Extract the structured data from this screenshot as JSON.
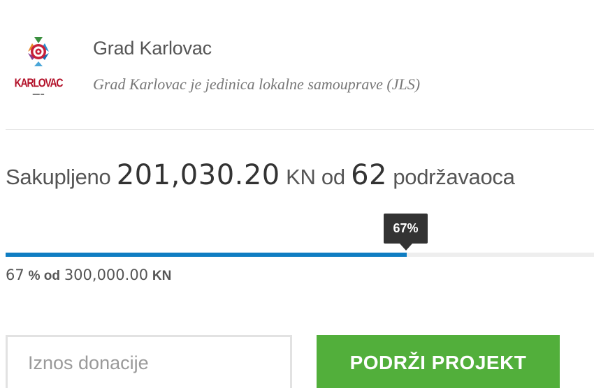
{
  "organizer": {
    "logo_text": "KARLOVAC",
    "name": "Grad Karlovac",
    "description": "Grad Karlovac je jedinica lokalne samouprave (JLS)"
  },
  "raised": {
    "prefix": "Sakupljeno",
    "amount": "201,030.20",
    "currency": "KN",
    "between": "od",
    "backers": "62",
    "suffix": "podržavaoca"
  },
  "progress": {
    "percent": 67,
    "tooltip": "67%",
    "percent_value": "67",
    "percent_unit": "% od",
    "goal_amount": "300,000.00",
    "goal_currency": "KN",
    "fill_color": "#0f7dc2"
  },
  "donation": {
    "placeholder": "Iznos donacije",
    "button_label": "PODRŽI PROJEKT",
    "button_color": "#52af3b"
  }
}
